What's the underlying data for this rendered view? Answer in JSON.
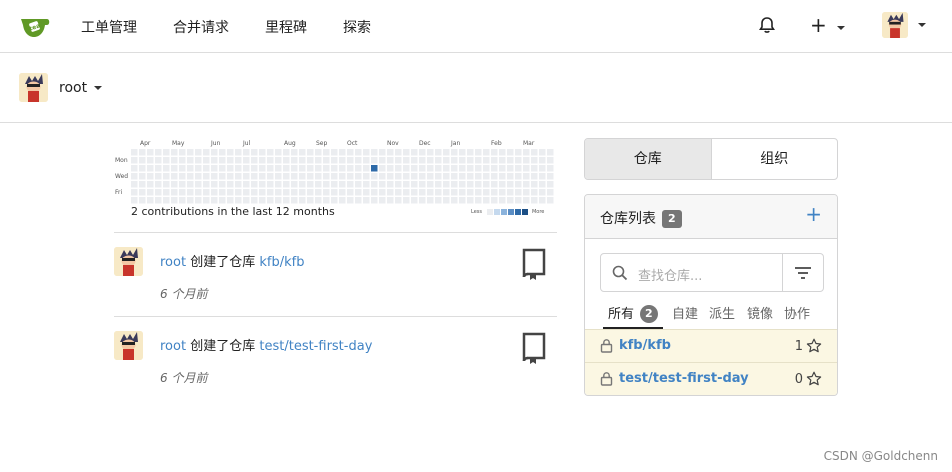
{
  "nav": {
    "items": [
      "工单管理",
      "合并请求",
      "里程碑",
      "探索"
    ],
    "logo_text": "tea",
    "plus_label": "+"
  },
  "user": {
    "name": "root"
  },
  "heatmap": {
    "months": [
      "Apr",
      "May",
      "Jun",
      "Jul",
      "Aug",
      "Sep",
      "Oct",
      "Nov",
      "Dec",
      "Jan",
      "Feb",
      "Mar"
    ],
    "days": [
      "Mon",
      "Wed",
      "Fri"
    ],
    "caption": "2 contributions in the last 12 months",
    "legend_less": "Less",
    "legend_more": "More",
    "contribution_level": 2,
    "colors": {
      "empty": "#ebedf0",
      "active": "#2e6aa8",
      "legend": [
        "#ebedf0",
        "#c5d9ee",
        "#8bb3dc",
        "#5a8dc4",
        "#2e6aa8",
        "#1c4f85"
      ]
    }
  },
  "feed": [
    {
      "user": "root",
      "action": "创建了仓库",
      "repo": "kfb/kfb",
      "time": "6 个月前"
    },
    {
      "user": "root",
      "action": "创建了仓库",
      "repo": "test/test-first-day",
      "time": "6 个月前"
    }
  ],
  "tabs": {
    "repos": "仓库",
    "orgs": "组织"
  },
  "repo_panel": {
    "title": "仓库列表",
    "count": "2",
    "search_placeholder": "查找仓库...",
    "filters": {
      "all": "所有",
      "all_count": "2",
      "own": "自建",
      "forks": "派生",
      "mirrors": "镜像",
      "collab": "协作"
    },
    "repos": [
      {
        "name": "kfb/kfb",
        "stars": "1"
      },
      {
        "name": "test/test-first-day",
        "stars": "0"
      }
    ]
  },
  "watermark": "CSDN @Goldchenn",
  "colors": {
    "link": "#4183c4",
    "row_bg": "#fbf7e3"
  }
}
